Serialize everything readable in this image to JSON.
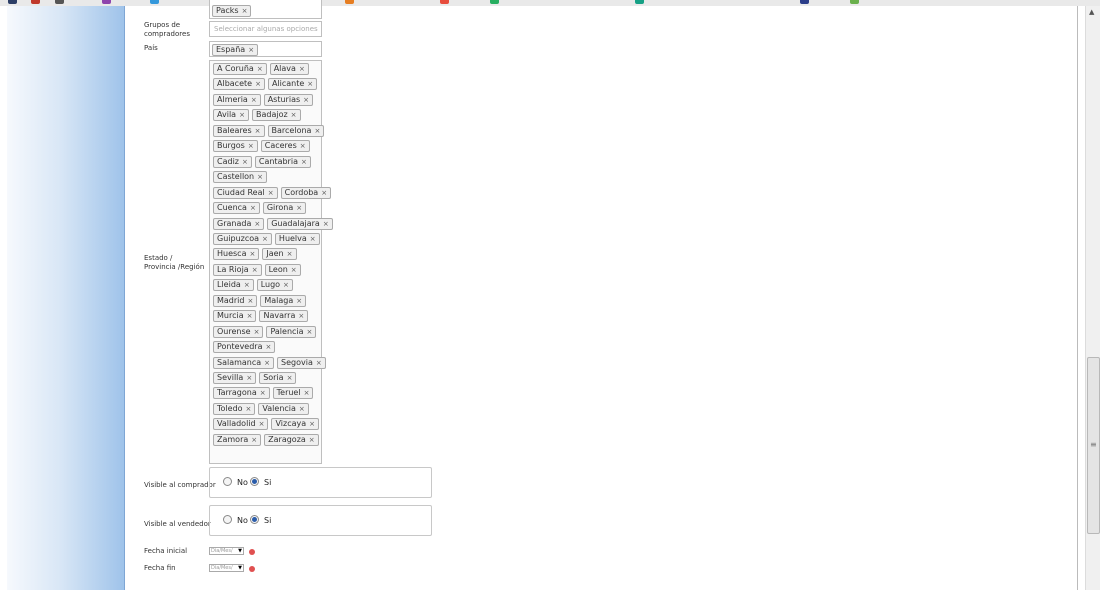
{
  "form": {
    "groups_label": "Grupos de compradores",
    "groups_placeholder": "Seleccionar algunas opciones",
    "packs_token": "Packs",
    "country_label": "País",
    "country_token": "España",
    "province_label": "Estado / Provincia /Región",
    "provinces": [
      [
        "A Coruña",
        "Alava"
      ],
      [
        "Albacete",
        "Alicante"
      ],
      [
        "Almeria",
        "Asturias"
      ],
      [
        "Avila",
        "Badajoz"
      ],
      [
        "Baleares",
        "Barcelona"
      ],
      [
        "Burgos",
        "Caceres"
      ],
      [
        "Cadiz",
        "Cantabria"
      ],
      [
        "Castellon"
      ],
      [
        "Ciudad Real",
        "Cordoba"
      ],
      [
        "Cuenca",
        "Girona"
      ],
      [
        "Granada",
        "Guadalajara"
      ],
      [
        "Guipuzcoa",
        "Huelva"
      ],
      [
        "Huesca",
        "Jaen"
      ],
      [
        "La Rioja",
        "Leon"
      ],
      [
        "Lleida",
        "Lugo"
      ],
      [
        "Madrid",
        "Malaga"
      ],
      [
        "Murcia",
        "Navarra"
      ],
      [
        "Ourense",
        "Palencia"
      ],
      [
        "Pontevedra"
      ],
      [
        "Salamanca",
        "Segovia"
      ],
      [
        "Sevilla",
        "Soria"
      ],
      [
        "Tarragona",
        "Teruel"
      ],
      [
        "Toledo",
        "Valencia"
      ],
      [
        "Valladolid",
        "Vizcaya"
      ],
      [
        "Zamora",
        "Zaragoza"
      ]
    ],
    "remove_symbol": "×",
    "visible_buyer_label": "Visible al comprador",
    "visible_seller_label": "Visible al vendedor",
    "radio_no": "No",
    "radio_si": "Si",
    "radio_selected": "Si",
    "start_date_label": "Fecha inicial",
    "end_date_label": "Fecha fin",
    "date_placeholder": "Dia/Mes/",
    "select_arrow": "▼"
  },
  "scrollbar": {
    "up_arrow": "▲",
    "grip": "≡"
  },
  "colors": {
    "left_panel": "#9fc3ea",
    "radio_checked": "#2a5caa",
    "error_icon": "#e05050"
  }
}
